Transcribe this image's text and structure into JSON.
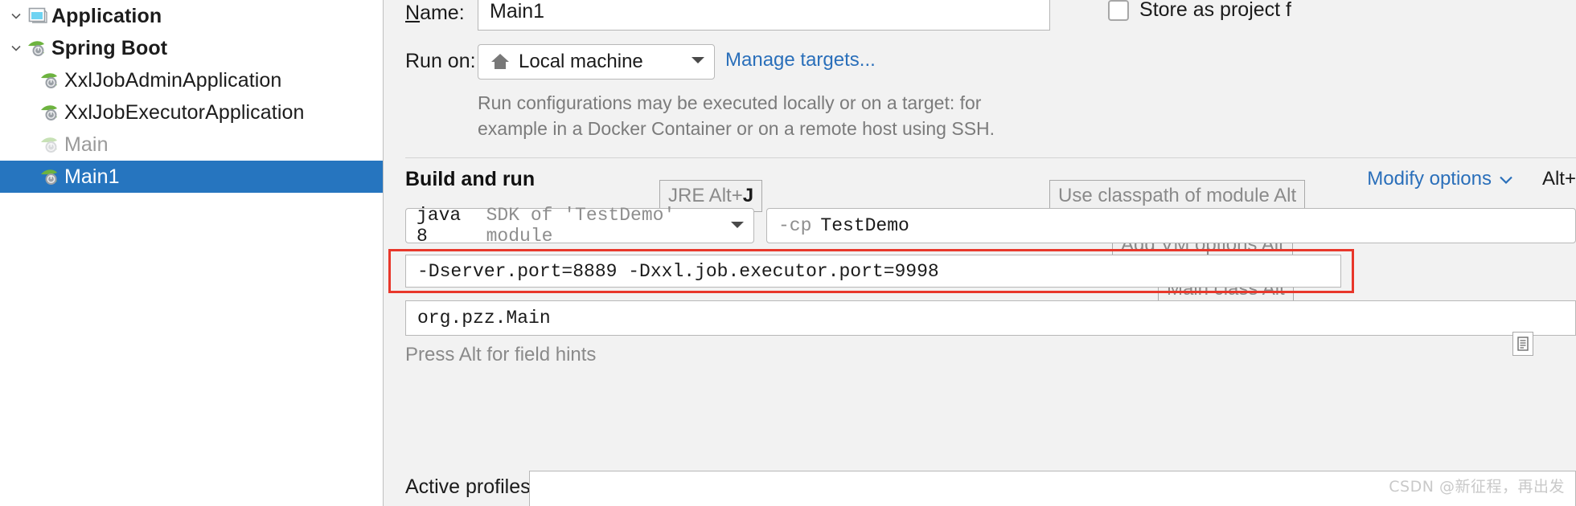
{
  "sidebar": {
    "items": [
      {
        "label": "Application",
        "icon": "application-window-icon",
        "bold": true,
        "indent": 1,
        "twisty": true,
        "muted": false,
        "selected": false
      },
      {
        "label": "Spring Boot",
        "icon": "spring-boot-leaf-icon",
        "bold": true,
        "indent": 1,
        "twisty": true,
        "muted": false,
        "selected": false
      },
      {
        "label": "XxlJobAdminApplication",
        "icon": "spring-boot-leaf-icon",
        "bold": false,
        "indent": 2,
        "twisty": false,
        "muted": false,
        "selected": false
      },
      {
        "label": "XxlJobExecutorApplication",
        "icon": "spring-boot-leaf-icon",
        "bold": false,
        "indent": 2,
        "twisty": false,
        "muted": false,
        "selected": false
      },
      {
        "label": "Main",
        "icon": "spring-boot-leaf-icon",
        "bold": false,
        "indent": 2,
        "twisty": false,
        "muted": true,
        "selected": false
      },
      {
        "label": "Main1",
        "icon": "spring-boot-leaf-icon",
        "bold": false,
        "indent": 2,
        "twisty": false,
        "muted": false,
        "selected": true
      }
    ]
  },
  "form": {
    "name_label_mnemonic": "N",
    "name_label_rest": "ame:",
    "name_value": "Main1",
    "store_as_project_mnemonic": "S",
    "store_as_project_rest": "tore as project f",
    "run_on_label": "Run on:",
    "run_on_value": "Local machine",
    "manage_targets_link": "Manage targets...",
    "hint_paragraph": "Run configurations may be executed locally or on a target: for example in a Docker Container or on a remote host using SSH.",
    "section_title": "Build and run",
    "modify_options_link": "Modify options",
    "modify_options_shortcut": "Alt+",
    "badge_jre_text": "JRE Alt+",
    "badge_jre_key": "J",
    "badge_classpath": "Use classpath of module Alt",
    "badge_vm_options": "Add VM options Alt",
    "badge_main_class": "Main class Alt",
    "sdk_main": "java 8",
    "sdk_sub": "SDK of 'TestDemo' module",
    "classpath_flag": "-cp",
    "classpath_value": "TestDemo",
    "vm_options_value": "-Dserver.port=8889  -Dxxl.job.executor.port=9998",
    "main_class_value": "org.pzz.Main",
    "press_alt_hint": "Press Alt for field hints",
    "active_profiles_label": "Active profiles:",
    "active_profiles_value": ""
  },
  "watermark": "CSDN @新征程，再出发",
  "colors": {
    "selection_blue": "#2675bf",
    "link_blue": "#2a6fba",
    "annotation_red": "#e8372b",
    "panel_bg": "#f2f2f2",
    "muted_text": "#8a8a8a"
  }
}
